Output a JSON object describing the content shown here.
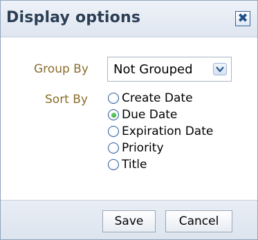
{
  "dialog": {
    "title": "Display options",
    "close_glyph": "✖",
    "close_icon": "close-icon"
  },
  "group_by": {
    "label": "Group By",
    "selected": "Not Grouped",
    "arrow_icon": "chevron-down-icon"
  },
  "sort_by": {
    "label": "Sort By",
    "options": [
      {
        "label": "Create Date",
        "checked": false
      },
      {
        "label": "Due Date",
        "checked": true
      },
      {
        "label": "Expiration Date",
        "checked": false
      },
      {
        "label": "Priority",
        "checked": false
      },
      {
        "label": "Title",
        "checked": false
      }
    ]
  },
  "footer": {
    "save_label": "Save",
    "cancel_label": "Cancel"
  },
  "colors": {
    "label_color": "#8a6d2a",
    "title_color": "#2c3e55",
    "accent": "#24589a",
    "selected_dot": "#1f9a1f"
  }
}
